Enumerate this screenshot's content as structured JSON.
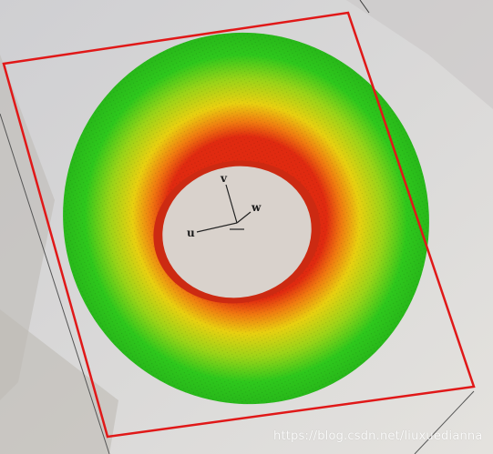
{
  "viewport": {
    "background_color": "#d8d6d3",
    "bounding_box_color": "#e01818",
    "colormap": [
      "#e02a10",
      "#f07a10",
      "#e8d010",
      "#9ad418",
      "#2ec81c"
    ]
  },
  "axes": {
    "u_label": "u",
    "v_label": "v",
    "w_label": "w"
  },
  "watermark": {
    "text": "https://blog.csdn.net/liuxuedianna"
  }
}
